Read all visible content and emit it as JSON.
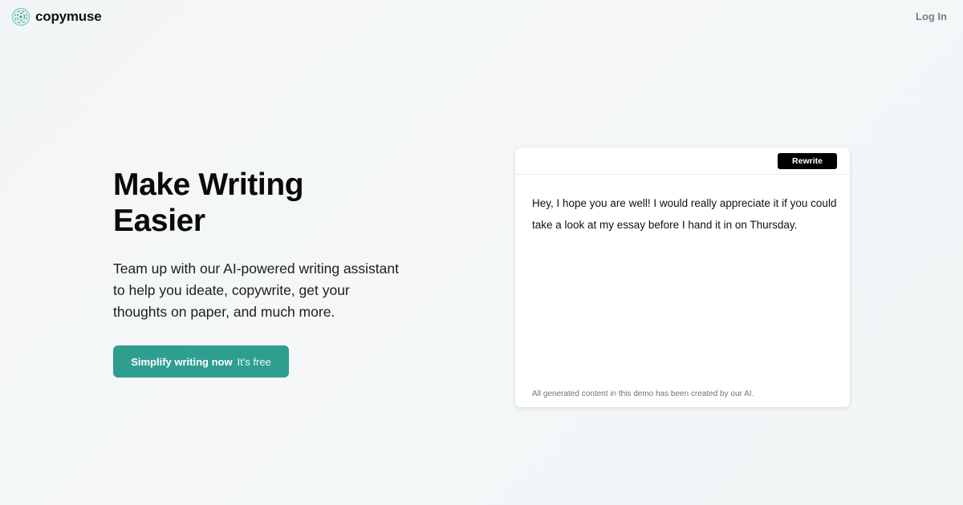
{
  "brand": {
    "name": "copymuse",
    "icon": "copymuse-logo-icon",
    "color": "#2e9e8f"
  },
  "nav": {
    "login_label": "Log In"
  },
  "hero": {
    "title_line1": "Make Writing",
    "title_line2": "Easier",
    "subtitle": "Team up with our AI-powered writing assistant to help you ideate, copywrite, get your thoughts on paper, and much more.",
    "cta_main": "Simplify writing now",
    "cta_sub": "It's free",
    "cta_color": "#2e9e8f"
  },
  "demo_card": {
    "rewrite_label": "Rewrite",
    "text": "Hey, I hope you are well! I would really appreciate it if you could take a look at my essay before I hand it in on Thursday.",
    "footnote": "All generated content in this demo has been created by our AI."
  }
}
